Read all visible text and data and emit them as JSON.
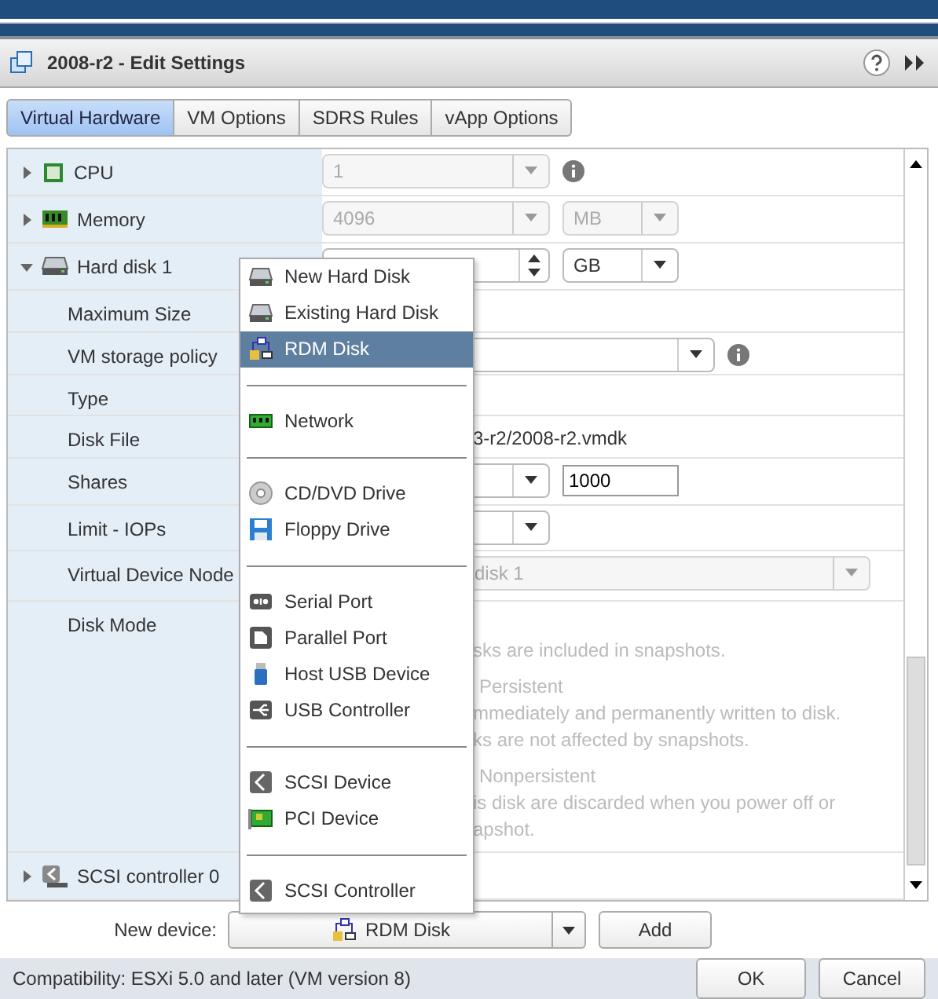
{
  "window": {
    "title": "2008-r2 - Edit Settings"
  },
  "tabs": [
    {
      "label": "Virtual Hardware",
      "selected": true
    },
    {
      "label": "VM Options",
      "selected": false
    },
    {
      "label": "SDRS Rules",
      "selected": false
    },
    {
      "label": "vApp Options",
      "selected": false
    }
  ],
  "rows": [
    {
      "label": "CPU",
      "expanded": false,
      "kind": "select",
      "value": "1",
      "disabled": true,
      "info": true
    },
    {
      "label": "Memory",
      "expanded": false,
      "kind": "select_unit",
      "value": "4096",
      "unit": "MB",
      "disabled": true
    },
    {
      "label": "Hard disk 1",
      "expanded": true,
      "kind": "spinner_unit",
      "unit": "GB",
      "disabled": false,
      "children": [
        {
          "label": "Maximum Size",
          "kind": "empty"
        },
        {
          "label": "VM storage policy",
          "kind": "select",
          "disabled": false,
          "info": true
        },
        {
          "label": "Type",
          "kind": "empty"
        },
        {
          "label": "Disk File",
          "kind": "text",
          "value": "3-r2/2008-r2.vmdk"
        },
        {
          "label": "Shares",
          "kind": "select_input",
          "input": "1000",
          "disabled": false
        },
        {
          "label": "Limit - IOPs",
          "kind": "select_short",
          "disabled": false
        },
        {
          "label": "Virtual Device Node",
          "kind": "select_wide",
          "value": "disk 1",
          "disabled": true
        },
        {
          "label": "Disk Mode",
          "kind": "lines",
          "lines": [
            {
              "text": "sks are included in snapshots.",
              "kind": "note"
            },
            {
              "text": "Persistent",
              "kind": "option"
            },
            {
              "text": "mmediately and permanently written to disk.",
              "kind": "note"
            },
            {
              "text": "ks are not affected by snapshots.",
              "kind": "note"
            },
            {
              "text": "Nonpersistent",
              "kind": "option"
            },
            {
              "text": "is disk are discarded when you power off or",
              "kind": "note"
            },
            {
              "text": "apshot.",
              "kind": "note"
            }
          ]
        }
      ]
    },
    {
      "label": "SCSI controller 0",
      "expanded": false,
      "kind": "empty"
    }
  ],
  "menu": [
    {
      "kind": "item",
      "label": "New Hard Disk",
      "selected": false
    },
    {
      "kind": "item",
      "label": "Existing Hard Disk",
      "selected": false
    },
    {
      "kind": "item",
      "label": "RDM Disk",
      "selected": true
    },
    {
      "kind": "separator"
    },
    {
      "kind": "item",
      "label": "Network",
      "selected": false
    },
    {
      "kind": "separator"
    },
    {
      "kind": "item",
      "label": "CD/DVD Drive",
      "selected": false
    },
    {
      "kind": "item",
      "label": "Floppy Drive",
      "selected": false
    },
    {
      "kind": "separator"
    },
    {
      "kind": "item",
      "label": "Serial Port",
      "selected": false
    },
    {
      "kind": "item",
      "label": "Parallel Port",
      "selected": false
    },
    {
      "kind": "item",
      "label": "Host USB Device",
      "selected": false
    },
    {
      "kind": "item",
      "label": "USB Controller",
      "selected": false
    },
    {
      "kind": "separator"
    },
    {
      "kind": "item",
      "label": "SCSI Device",
      "selected": false
    },
    {
      "kind": "item",
      "label": "PCI Device",
      "selected": false
    },
    {
      "kind": "separator"
    },
    {
      "kind": "item",
      "label": "SCSI Controller",
      "selected": false
    }
  ],
  "new_device": {
    "label": "New device:",
    "value": "RDM Disk",
    "add_button": "Add"
  },
  "status_bar": {
    "compatibility": "Compatibility: ESXi 5.0 and later (VM version 8)"
  },
  "buttons": [
    "OK",
    "Cancel"
  ]
}
